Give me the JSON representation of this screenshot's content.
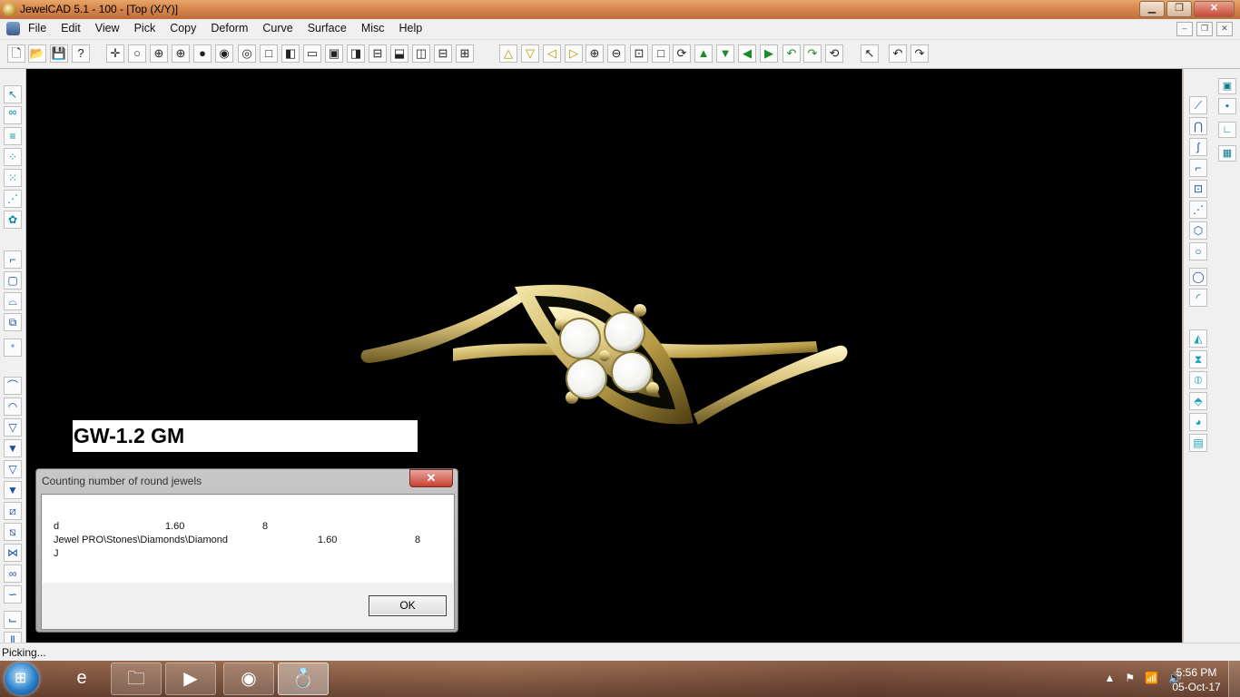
{
  "window": {
    "title": "JewelCAD 5.1 - 100 - [Top (X/Y)]",
    "min": "▁",
    "restore": "❐",
    "close": "✕"
  },
  "menu": {
    "items": [
      "File",
      "Edit",
      "View",
      "Pick",
      "Copy",
      "Deform",
      "Curve",
      "Surface",
      "Misc",
      "Help"
    ],
    "mdi_min": "–",
    "mdi_restore": "❐",
    "mdi_close": "✕"
  },
  "toolbar": {
    "icons": [
      {
        "name": "new-file-icon",
        "glyph": "🗋"
      },
      {
        "name": "open-folder-icon",
        "glyph": "📂"
      },
      {
        "name": "save-icon",
        "glyph": "💾"
      },
      {
        "name": "help-cursor-icon",
        "glyph": "?"
      },
      {
        "name": "crosshair-icon",
        "glyph": "✛"
      },
      {
        "name": "circle-icon",
        "glyph": "○"
      },
      {
        "name": "circle-cross-icon",
        "glyph": "⊕"
      },
      {
        "name": "target-icon",
        "glyph": "⊕"
      },
      {
        "name": "sphere-icon",
        "glyph": "●"
      },
      {
        "name": "shaded-sphere-icon",
        "glyph": "◉"
      },
      {
        "name": "render-icon",
        "glyph": "◎"
      },
      {
        "name": "view-single-icon",
        "glyph": "□"
      },
      {
        "name": "view-left-icon",
        "glyph": "◧"
      },
      {
        "name": "view-top-icon",
        "glyph": "▭"
      },
      {
        "name": "view-front-icon",
        "glyph": "▣"
      },
      {
        "name": "view-right-icon",
        "glyph": "◨"
      },
      {
        "name": "view-back-icon",
        "glyph": "⊟"
      },
      {
        "name": "view-bottom-icon",
        "glyph": "⬓"
      },
      {
        "name": "view-split-vertical-icon",
        "glyph": "◫"
      },
      {
        "name": "view-split-horizontal-icon",
        "glyph": "⊟"
      },
      {
        "name": "view-quad-icon",
        "glyph": "⊞"
      },
      {
        "name": "triangle-up-icon",
        "glyph": "△"
      },
      {
        "name": "triangle-down-icon",
        "glyph": "▽"
      },
      {
        "name": "triangle-left-icon",
        "glyph": "◁"
      },
      {
        "name": "triangle-right-icon",
        "glyph": "▷"
      },
      {
        "name": "zoom-in-icon",
        "glyph": "⊕"
      },
      {
        "name": "zoom-out-icon",
        "glyph": "⊖"
      },
      {
        "name": "zoom-window-icon",
        "glyph": "⊡"
      },
      {
        "name": "zoom-fit-icon",
        "glyph": "□"
      },
      {
        "name": "zoom-all-icon",
        "glyph": "⟳"
      },
      {
        "name": "rotate-up-icon",
        "glyph": "▲"
      },
      {
        "name": "rotate-down-icon",
        "glyph": "▼"
      },
      {
        "name": "rotate-left-icon",
        "glyph": "◀"
      },
      {
        "name": "rotate-right-icon",
        "glyph": "▶"
      },
      {
        "name": "spin-left-icon",
        "glyph": "↶"
      },
      {
        "name": "spin-right-icon",
        "glyph": "↷"
      },
      {
        "name": "orbit-icon",
        "glyph": "⟲"
      },
      {
        "name": "select-arrow-icon",
        "glyph": "↖"
      },
      {
        "name": "undo-icon",
        "glyph": "↶"
      },
      {
        "name": "redo-icon",
        "glyph": "↷"
      }
    ]
  },
  "left_toolbar": {
    "icons": [
      {
        "name": "pick-cursor-icon",
        "glyph": "↖"
      },
      {
        "name": "pick-loop-icon",
        "glyph": "ᅇ"
      },
      {
        "name": "pick-stack-icon",
        "glyph": "≡"
      },
      {
        "name": "pick-points-icon",
        "glyph": "⁘"
      },
      {
        "name": "pick-grid-icon",
        "glyph": "⁙"
      },
      {
        "name": "pick-chain-icon",
        "glyph": "⋰"
      },
      {
        "name": "pick-cluster-icon",
        "glyph": "✿"
      },
      {
        "name": "pointer-icon",
        "glyph": "⌐"
      },
      {
        "name": "box-icon",
        "glyph": "▢"
      },
      {
        "name": "dome-icon",
        "glyph": "⌓"
      },
      {
        "name": "copy-object-icon",
        "glyph": "⧉"
      },
      {
        "name": "point-plus-icon",
        "glyph": "⁺"
      },
      {
        "name": "curve-arc-icon",
        "glyph": "⌒"
      },
      {
        "name": "curve-loop-icon",
        "glyph": "◠"
      },
      {
        "name": "cone-icon",
        "glyph": "▽"
      },
      {
        "name": "cone-filled-icon",
        "glyph": "▼"
      },
      {
        "name": "funnel-icon",
        "glyph": "▽"
      },
      {
        "name": "funnel-bold-icon",
        "glyph": "▼"
      },
      {
        "name": "slant-icon",
        "glyph": "⧄"
      },
      {
        "name": "slant-bold-icon",
        "glyph": "⧅"
      },
      {
        "name": "bowtie-icon",
        "glyph": "⋈"
      },
      {
        "name": "infinity-icon",
        "glyph": "∞"
      },
      {
        "name": "twist-icon",
        "glyph": "∽"
      },
      {
        "name": "bend-icon",
        "glyph": "⌙"
      },
      {
        "name": "array-icon",
        "glyph": "⫼"
      }
    ]
  },
  "right_toolbar": {
    "icons": [
      {
        "name": "curve-line-icon",
        "glyph": "⟋"
      },
      {
        "name": "curve-arch-icon",
        "glyph": "⋂"
      },
      {
        "name": "curve-s-icon",
        "glyph": "∫"
      },
      {
        "name": "curve-step-icon",
        "glyph": "⌐"
      },
      {
        "name": "curve-box-icon",
        "glyph": "⊡"
      },
      {
        "name": "curve-polyline-icon",
        "glyph": "⋰"
      },
      {
        "name": "curve-polygon-icon",
        "glyph": "⬡"
      },
      {
        "name": "circle-small-icon",
        "glyph": "○"
      },
      {
        "name": "ellipse-icon",
        "glyph": "◯"
      },
      {
        "name": "arc-icon",
        "glyph": "◜"
      },
      {
        "name": "surface-extrude-icon",
        "glyph": "◭"
      },
      {
        "name": "surface-revolve-icon",
        "glyph": "⧗"
      },
      {
        "name": "surface-pipe-icon",
        "glyph": "⦶"
      },
      {
        "name": "surface-loft-icon",
        "glyph": "⬘"
      },
      {
        "name": "surface-sweep-icon",
        "glyph": "◕"
      },
      {
        "name": "surface-patch-icon",
        "glyph": "▤"
      }
    ],
    "side_icons": [
      {
        "name": "layer-icon",
        "glyph": "▣"
      },
      {
        "name": "point-snap-icon",
        "glyph": "▪"
      },
      {
        "name": "corner-icon",
        "glyph": "∟"
      },
      {
        "name": "grid-icon",
        "glyph": "▦"
      }
    ]
  },
  "viewport": {
    "label": "GW-1.2 GM"
  },
  "dialog": {
    "title": "Counting number of round jewels",
    "close": "✕",
    "rows": [
      {
        "name": "d",
        "size": "1.60",
        "count": "8"
      },
      {
        "name": "Jewel PRO\\Stones\\Diamonds\\Diamond",
        "size": "1.60",
        "count": "8"
      },
      {
        "name": "J",
        "size": "",
        "count": ""
      }
    ],
    "ok": "OK"
  },
  "status": {
    "text": "Picking..."
  },
  "taskbar": {
    "start": "⊞",
    "apps": [
      {
        "name": "internet-explorer-icon",
        "glyph": "e"
      },
      {
        "name": "file-explorer-icon",
        "glyph": "🗀"
      },
      {
        "name": "media-player-icon",
        "glyph": "▶"
      },
      {
        "name": "chrome-icon",
        "glyph": "◉"
      },
      {
        "name": "jewelcad-icon",
        "glyph": "💍"
      }
    ],
    "tray": [
      "▲",
      "⚑",
      "📶",
      "🔊"
    ],
    "time": "5:56 PM",
    "date": "05-Oct-17"
  }
}
